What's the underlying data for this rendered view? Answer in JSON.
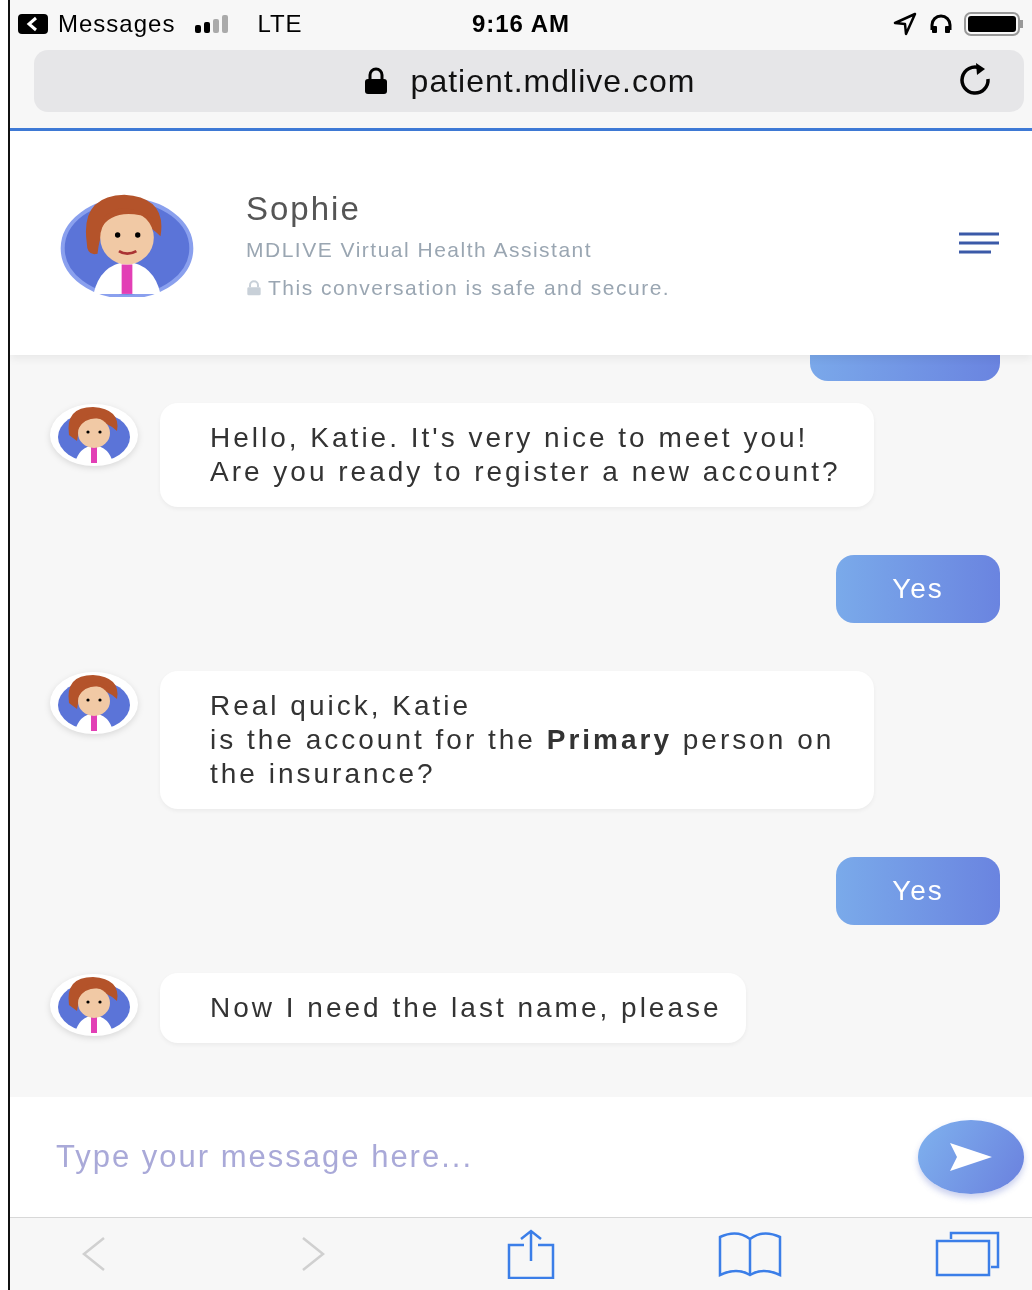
{
  "status_bar": {
    "back_app": "Messages",
    "carrier": "LTE",
    "time": "9:16 AM"
  },
  "address_bar": {
    "url": "patient.mdlive.com"
  },
  "header": {
    "name": "Sophie",
    "role": "MDLIVE Virtual Health Assistant",
    "security_note": "This conversation is safe and secure."
  },
  "messages": [
    {
      "kind": "bot",
      "text": "Hello, Katie. It's very nice to meet you! Are you ready to register a new account?"
    },
    {
      "kind": "user",
      "text": "Yes"
    },
    {
      "kind": "bot",
      "text": "Real quick, Katie\nis the account for the **Primary** person on the insurance?"
    },
    {
      "kind": "user",
      "text": "Yes"
    },
    {
      "kind": "bot",
      "text": "Now I need the last name, please"
    }
  ],
  "composer": {
    "placeholder": "Type your message here..."
  },
  "toolbar": [
    {
      "kind": "back",
      "disabled": true
    },
    {
      "kind": "forward",
      "disabled": true
    },
    {
      "kind": "share",
      "disabled": false
    },
    {
      "kind": "bookmarks",
      "disabled": false
    },
    {
      "kind": "tabs",
      "disabled": false
    }
  ]
}
